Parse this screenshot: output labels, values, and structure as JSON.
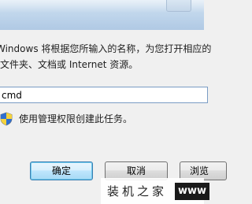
{
  "dialog": {
    "description_line1": "Windows 将根据您所输入的名称，为您打开相应的",
    "description_line2": "文件夹、文档或 Internet 资源。",
    "command_value": "cmd",
    "admin_note": "使用管理权限创建此任务。"
  },
  "buttons": {
    "ok": "确定",
    "cancel": "取消",
    "browse": "浏览"
  },
  "watermark": {
    "text": "装机之家",
    "url": "www"
  },
  "icons": {
    "shield": "uac-shield-icon"
  },
  "colors": {
    "title_band": "#bcd3ea",
    "dialog_bg": "#f0f0f0",
    "ok_border": "#3c7fb1"
  }
}
